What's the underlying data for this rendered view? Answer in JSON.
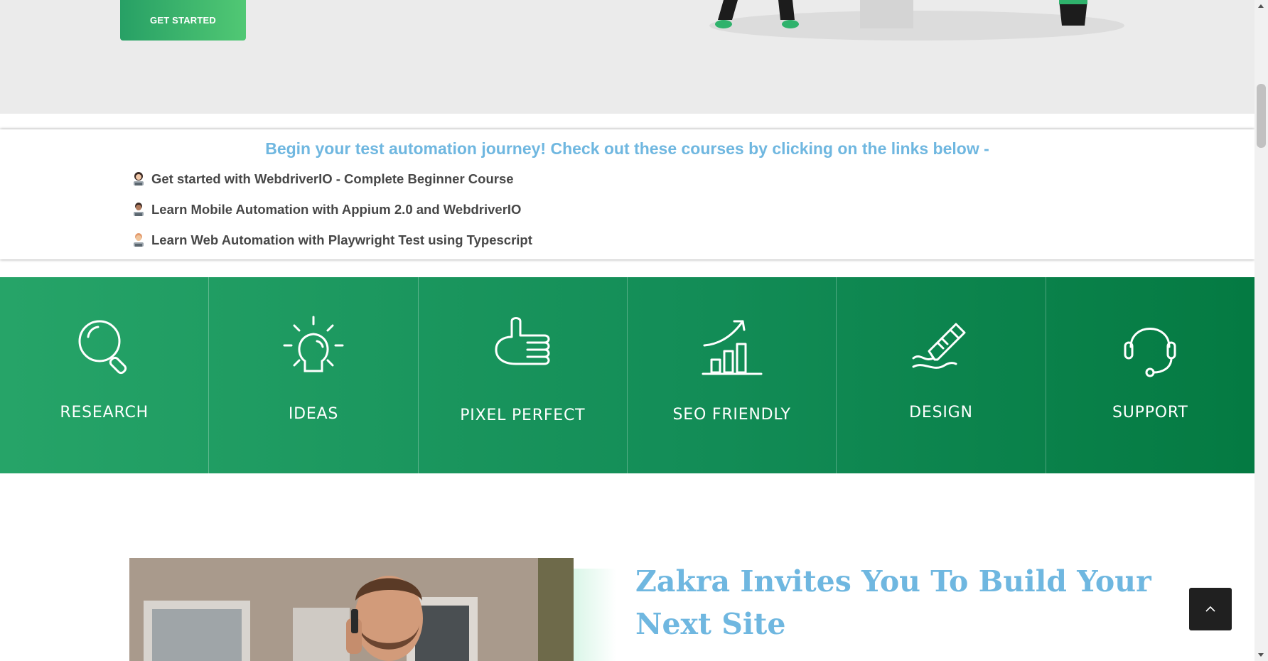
{
  "hero": {
    "cta_label": "GET STARTED"
  },
  "courses": {
    "heading": "Begin your test automation journey! Check out these courses by clicking on the links below -",
    "links": [
      {
        "label": "Get started with WebdriverIO - Complete Beginner Course",
        "icon": "woman-technologist-emoji"
      },
      {
        "label": "Learn Mobile Automation with Appium 2.0 and WebdriverIO",
        "icon": "man-technologist-emoji"
      },
      {
        "label": "Learn Web Automation with Playwright Test using Typescript",
        "icon": "technologist-emoji"
      }
    ]
  },
  "features": [
    {
      "label": "RESEARCH",
      "icon": "magnifier-icon"
    },
    {
      "label": "IDEAS",
      "icon": "lightbulb-icon"
    },
    {
      "label": "PIXEL PERFECT",
      "icon": "thumbs-up-icon"
    },
    {
      "label": "SEO FRIENDLY",
      "icon": "growth-chart-icon"
    },
    {
      "label": "DESIGN",
      "icon": "pencil-icon"
    },
    {
      "label": "SUPPORT",
      "icon": "headset-icon"
    }
  ],
  "about": {
    "title": "Zakra Invites You To Build Your Next Site"
  },
  "colors": {
    "accent_green": "#1a9a5e",
    "heading_blue": "#6fb7e0",
    "hero_bg": "#ebebeb"
  }
}
